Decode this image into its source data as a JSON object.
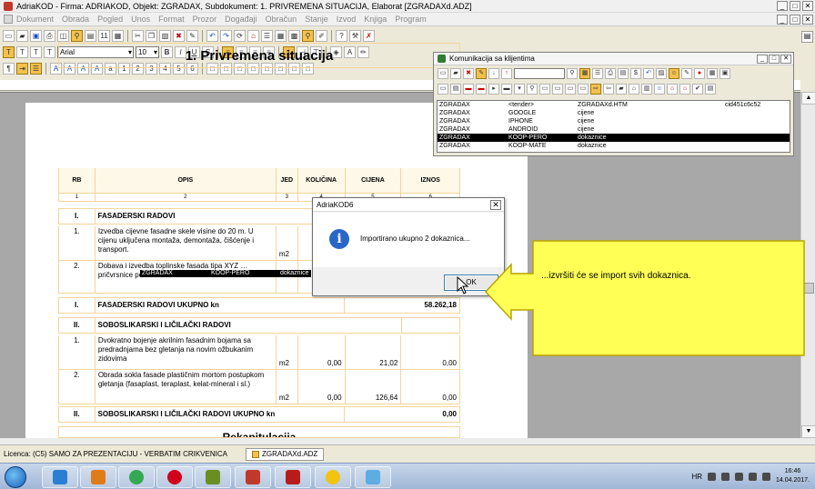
{
  "window": {
    "title": "AdriaKOD - Firma: ADRIAKOD,   Objekt: ZGRADAX,   Subdokument: 1. PRIVREMENA SITUACIJA,   Elaborat [ZGRADAXd.ADZ]"
  },
  "menu": [
    "Dokument",
    "Obrada",
    "Pogled",
    "Unos",
    "Format",
    "Prozor",
    "Događaji",
    "Obračun",
    "Stanje",
    "Izvod",
    "Knjiga",
    "Program"
  ],
  "format_toolbar": {
    "font": "Arial",
    "size": "10"
  },
  "document": {
    "title": "1. Privremena situacija",
    "headers": [
      "RB",
      "OPIS",
      "JED",
      "KOLIČINA",
      "CIJENA",
      "IZNOS"
    ],
    "col_numbers": [
      "1",
      "2",
      "3",
      "4",
      "5",
      "6"
    ],
    "sections": [
      {
        "code": "I.",
        "name": "FASADERSKI RADOVI",
        "items": [
          {
            "rb": "1.",
            "opis": "Izvedba cijevne fasadne skele visine do 20 m. U cijenu uključena montaža, demontaža, čišćenje i transport.",
            "jed": "m2",
            "kolicina": "",
            "cijena": "",
            "iznos": ""
          },
          {
            "rb": "2.",
            "opis": "Dobava i izvedba toplinske fasada tipa XYZ … pričvrsnice poliamidne",
            "jed": "",
            "kolicina": "",
            "cijena": "",
            "iznos": ""
          }
        ],
        "total_label": "FASADERSKI RADOVI UKUPNO kn",
        "total": "58.262,18"
      },
      {
        "code": "II.",
        "name": "SOBOSLIKARSKI I LIČILAČKI RADOVI",
        "items": [
          {
            "rb": "1.",
            "opis": "Dvokratno bojenje akrilnim fasadnim bojama sa predradnjama bez gletanja na novim ožbukanim zidovima",
            "jed": "m2",
            "kolicina": "0,00",
            "cijena": "21,02",
            "iznos": "0,00"
          },
          {
            "rb": "2.",
            "opis": "Obrada sokla fasade plastičnim mortom postupkom gletanja (fasaplast, teraplast, kelat-mineral i sl.)",
            "jed": "m2",
            "kolicina": "0,00",
            "cijena": "126,64",
            "iznos": "0,00"
          }
        ],
        "total_label": "SOBOSLIKARSKI I LIČILAČKI RADOVI UKUPNO kn",
        "total": "0,00"
      }
    ],
    "next_section_partial": "Rekapitulacija"
  },
  "comm_window": {
    "title": "Komunikacija sa klijentima",
    "rows": [
      {
        "a": "ZGRADAX",
        "b": "<tender>",
        "c": "ZGRADAXd.HTM",
        "d": "cid451c6c52",
        "selected": false
      },
      {
        "a": "ZGRADAX",
        "b": "GOOGLE",
        "c": "cijene",
        "d": "",
        "selected": false
      },
      {
        "a": "ZGRADAX",
        "b": "IPHONE",
        "c": "cijene",
        "d": "",
        "selected": false
      },
      {
        "a": "ZGRADAX",
        "b": "ANDROID",
        "c": "cijene",
        "d": "",
        "selected": false
      },
      {
        "a": "ZGRADAX",
        "b": "KOOP-PERO",
        "c": "dokaznice",
        "d": "",
        "selected": true
      },
      {
        "a": "ZGRADAX",
        "b": "KOOP-MATE",
        "c": "dokaznice",
        "d": "",
        "selected": false
      }
    ]
  },
  "drag_overlay": {
    "a": "ZGRADAX",
    "b": "KOOP-PERO",
    "c": "dokaznice"
  },
  "dialog": {
    "title": "AdriaKOD6",
    "message": "Importirano ukupno 2 dokaznica...",
    "ok_label": "OK"
  },
  "callout": {
    "text": "...izvršiti će se import svih dokaznica."
  },
  "status": {
    "licence": "Licenca: (C5) SAMO ZA PREZENTACIJU - VERBATIM CRIKVENICA",
    "file_tab": "ZGRADAXd.ADZ"
  },
  "taskbar": {
    "lang": "HR",
    "time": "16:46",
    "date": "14.04.2017."
  },
  "colors": {
    "table_border": "#f3d59a",
    "callout_fill": "#ffff55",
    "callout_stroke": "#b8a400",
    "selection": "#000000"
  }
}
